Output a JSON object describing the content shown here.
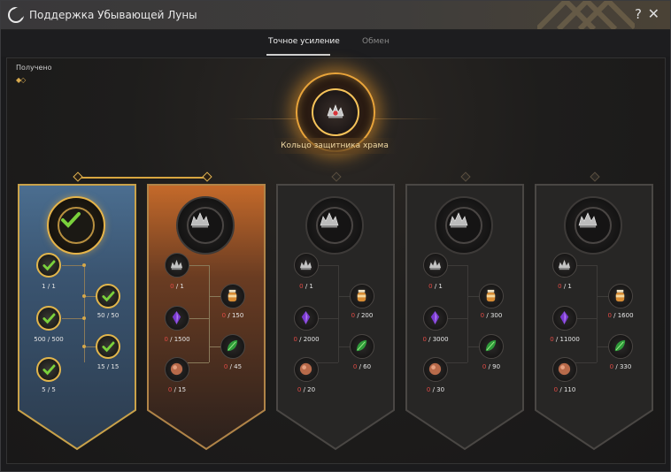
{
  "window": {
    "title": "Поддержка Убывающей Луны",
    "help": "?",
    "close": "✕"
  },
  "tabs": [
    {
      "label": "Точное усиление",
      "active": true
    },
    {
      "label": "Обмен",
      "active": false
    }
  ],
  "obtained": {
    "label": "Получено",
    "marks": "◆◇"
  },
  "reward": {
    "name": "Кольцо защитника храма",
    "icon": "crown-gem-icon"
  },
  "colors": {
    "gold": "#e3b451",
    "need": "#e04a45",
    "blue_banner": "#3f5c78",
    "orange_banner": "#b8642a"
  },
  "stages": [
    {
      "state": "completed",
      "items": [
        {
          "icon": "check-icon",
          "have": "1",
          "need": "1",
          "label": "1 / 1"
        },
        {
          "icon": "check-icon",
          "have": "50",
          "need": "50",
          "label": "50 / 50"
        },
        {
          "icon": "check-icon",
          "have": "500",
          "need": "500",
          "label": "500 / 500"
        },
        {
          "icon": "check-icon",
          "have": "15",
          "need": "15",
          "label": "15 / 15"
        },
        {
          "icon": "check-icon",
          "have": "5",
          "need": "5",
          "label": "5 / 5"
        }
      ]
    },
    {
      "state": "active",
      "items": [
        {
          "icon": "silver-crown-icon",
          "have": "0",
          "need": "1"
        },
        {
          "icon": "orange-jar-icon",
          "have": "0",
          "need": "150"
        },
        {
          "icon": "purple-crystal-icon",
          "have": "0",
          "need": "1500"
        },
        {
          "icon": "green-leaf-icon",
          "have": "0",
          "need": "45"
        },
        {
          "icon": "copper-orb-icon",
          "have": "0",
          "need": "15"
        }
      ]
    },
    {
      "state": "locked",
      "items": [
        {
          "icon": "silver-crown-icon",
          "have": "0",
          "need": "1"
        },
        {
          "icon": "orange-jar-icon",
          "have": "0",
          "need": "200"
        },
        {
          "icon": "purple-crystal-icon",
          "have": "0",
          "need": "2000"
        },
        {
          "icon": "green-leaf-icon",
          "have": "0",
          "need": "60"
        },
        {
          "icon": "copper-orb-icon",
          "have": "0",
          "need": "20"
        }
      ]
    },
    {
      "state": "locked",
      "items": [
        {
          "icon": "silver-crown-icon",
          "have": "0",
          "need": "1"
        },
        {
          "icon": "orange-jar-icon",
          "have": "0",
          "need": "300"
        },
        {
          "icon": "purple-crystal-icon",
          "have": "0",
          "need": "3000"
        },
        {
          "icon": "green-leaf-icon",
          "have": "0",
          "need": "90"
        },
        {
          "icon": "copper-orb-icon",
          "have": "0",
          "need": "30"
        }
      ]
    },
    {
      "state": "locked",
      "items": [
        {
          "icon": "silver-crown-icon",
          "have": "0",
          "need": "1"
        },
        {
          "icon": "orange-jar-icon",
          "have": "0",
          "need": "1600"
        },
        {
          "icon": "purple-crystal-icon",
          "have": "0",
          "need": "11000"
        },
        {
          "icon": "green-leaf-icon",
          "have": "0",
          "need": "330"
        },
        {
          "icon": "copper-orb-icon",
          "have": "0",
          "need": "110"
        }
      ]
    }
  ]
}
